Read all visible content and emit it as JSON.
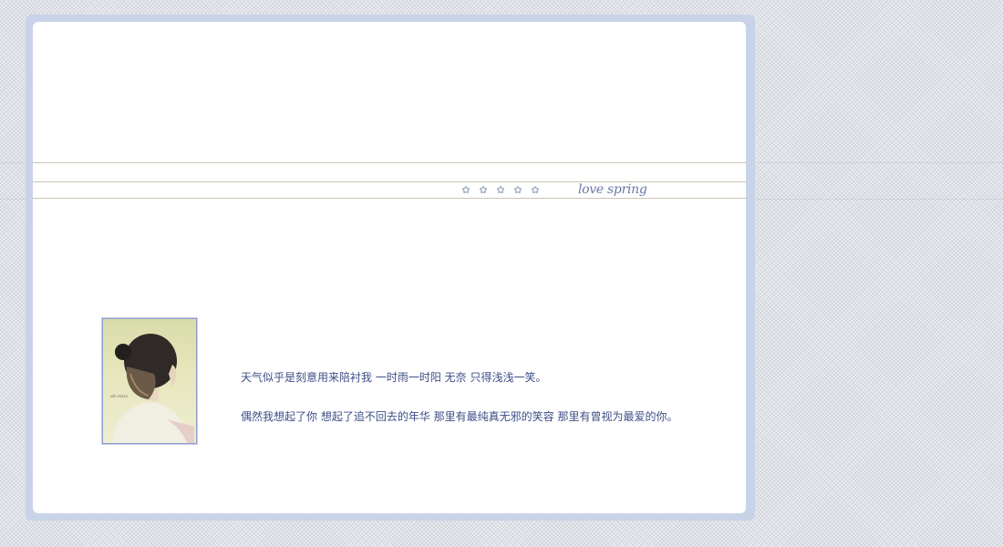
{
  "header": {
    "tagline": "love spring",
    "ornament_icons": [
      "flower-icon",
      "flower-icon",
      "flower-icon",
      "flower-icon",
      "flower-icon"
    ]
  },
  "post": {
    "image_icon": "photo-girl-back-view",
    "lines": [
      "天气似乎是刻意用来陪衬我  一时雨一时阳  无奈  只得浅浅一笑。",
      "偶然我想起了你  想起了追不回去的年华  那里有最纯真无邪的笑容  那里有曾视为最爱的你。"
    ]
  },
  "colors": {
    "frame": "#c9d3e8",
    "card": "#ffffff",
    "text": "#3d4f86",
    "tagline": "#6b79a4",
    "rule": "#c9c5b4"
  }
}
